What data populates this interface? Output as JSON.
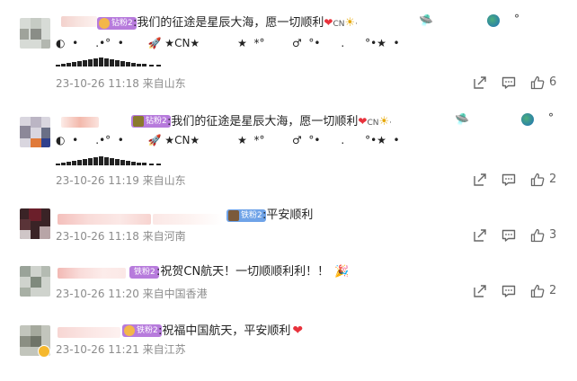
{
  "comments": [
    {
      "badge_label": "钻粉2",
      "text": ":我们的征途是星辰大海，愿一切顺利",
      "suffix": "CN",
      "line2": "◐  •     .•°  •       🚀 ★CN★           ★  *°        ♂  °•      .      °•★  •",
      "meta": "23-10-26 11:18 来自山东",
      "like_count": "6"
    },
    {
      "badge_label": "钻粉2",
      "text": ":我们的征途是星辰大海，愿一切顺利",
      "suffix": "CN",
      "line2": "◐  •     .•°  •       🚀 ★CN★           ★  *°        ♂  °•      .      °•★  •",
      "meta": "23-10-26 11:19 来自山东",
      "like_count": "2"
    },
    {
      "badge_label": "铁粉2",
      "text": ":平安顺利",
      "meta": "23-10-26 11:18 来自河南",
      "like_count": "3"
    },
    {
      "badge_label": "铁粉2",
      "text": ":祝贺CN航天！一切顺顺利利！！",
      "meta": "23-10-26 11:20 来自中国香港",
      "like_count": "2"
    },
    {
      "badge_label": "铁粉2",
      "text": ":祝福中国航天，平安顺利",
      "meta": "23-10-26 11:21 来自江苏",
      "like_count": ""
    }
  ],
  "icons": {
    "share": "share-icon",
    "comment": "comment-icon",
    "like": "like-icon"
  },
  "colors": {
    "badge_diamond": "#b77bdc",
    "badge_iron": "#6fa3e8",
    "meta_text": "#8c8c8c",
    "heart": "#e8323c"
  }
}
